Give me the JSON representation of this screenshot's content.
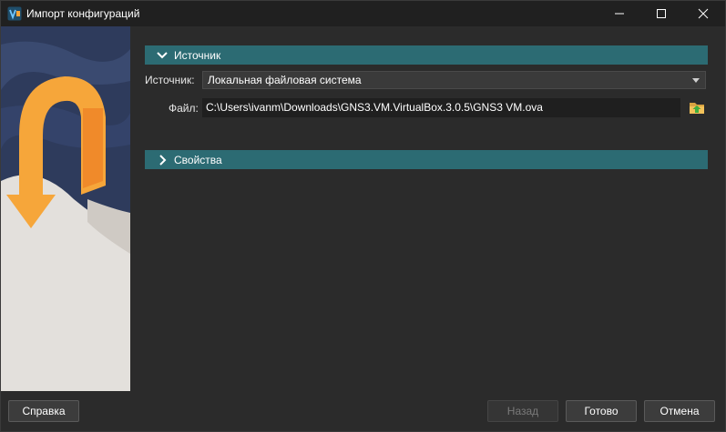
{
  "window": {
    "title": "Импорт конфигураций",
    "icon": "virtualbox-logo-icon"
  },
  "titlebar_buttons": {
    "minimize": "minimize-icon",
    "maximize": "maximize-icon",
    "close": "close-icon"
  },
  "sections": {
    "source": {
      "title": "Источник",
      "expanded": true
    },
    "properties": {
      "title": "Свойства",
      "expanded": false
    }
  },
  "source": {
    "source_label": "Источник:",
    "source_value": "Локальная файловая система",
    "file_label": "Файл:",
    "file_value": "C:\\Users\\ivanm\\Downloads\\GNS3.VM.VirtualBox.3.0.5\\GNS3 VM.ova",
    "browse_icon": "folder-open-icon"
  },
  "footer": {
    "help": "Справка",
    "back": "Назад",
    "finish": "Готово",
    "cancel": "Отмена"
  },
  "colors": {
    "section_header": "#2c6b73",
    "background": "#2b2b2b",
    "titlebar": "#202020",
    "arrow_orange": "#f6a63a"
  }
}
